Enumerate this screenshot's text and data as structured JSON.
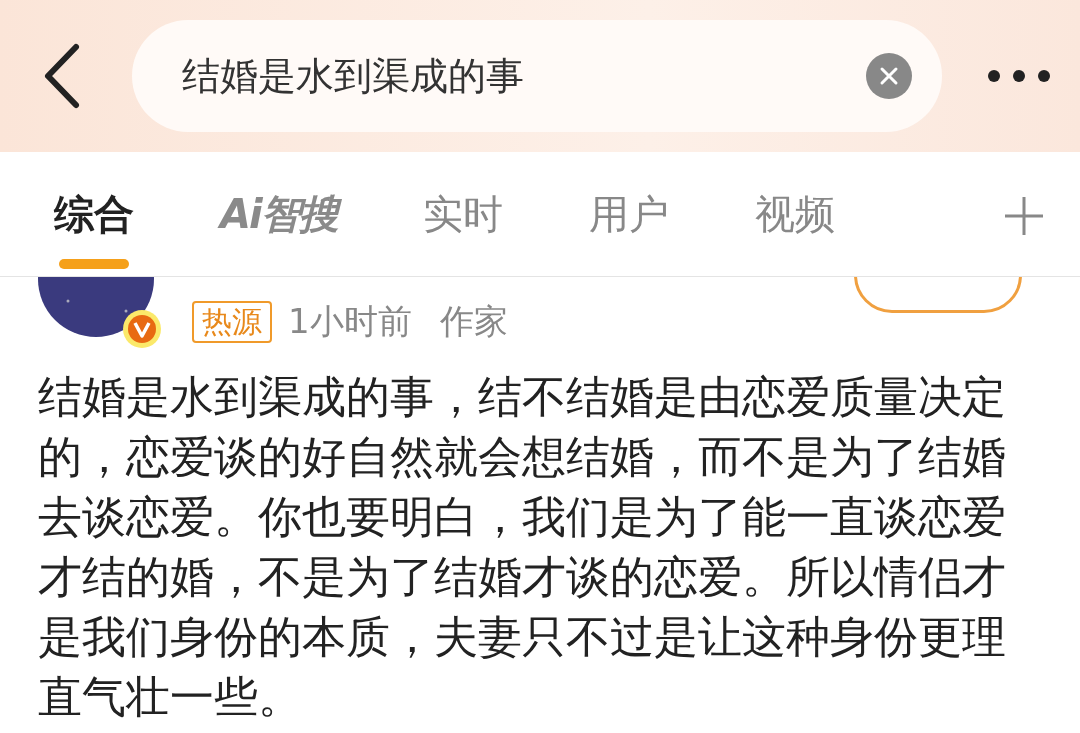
{
  "search": {
    "value": "结婚是水到渠成的事"
  },
  "tabs": [
    {
      "label": "综合",
      "selected": true,
      "kind": "text"
    },
    {
      "label": "Ai智搜",
      "selected": false,
      "kind": "ai"
    },
    {
      "label": "实时",
      "selected": false,
      "kind": "text"
    },
    {
      "label": "用户",
      "selected": false,
      "kind": "text"
    },
    {
      "label": "视频",
      "selected": false,
      "kind": "text"
    }
  ],
  "post": {
    "verified": true,
    "tag": "热源",
    "time": "1小时前",
    "source": "作家",
    "text": "结婚是水到渠成的事，结不结婚是由恋爱质量决定的，恋爱谈的好自然就会想结婚，而不是为了结婚去谈恋爱。你也要明白，我们是为了能一直谈恋爱才结的婚，不是为了结婚才谈的恋爱。所以情侣才是我们身份的本质，夫妻只不过是让这种身份更理直气壮一些。"
  }
}
